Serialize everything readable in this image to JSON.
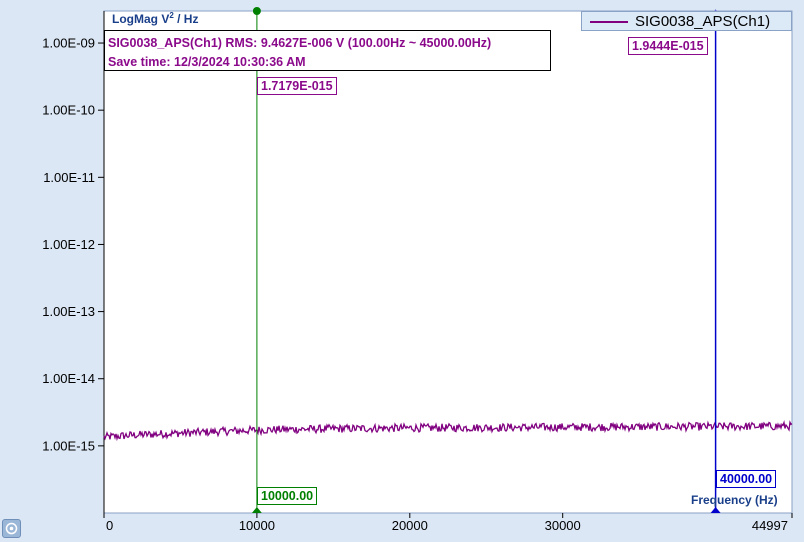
{
  "chart_data": {
    "type": "line",
    "ylabel_text": "LogMag V",
    "ylabel_sup": "2",
    "ylabel_tail": " / Hz",
    "xlabel": "Frequency (Hz)",
    "yscale": "log",
    "ylim": [
      1e-16,
      3e-09
    ],
    "xlim": [
      0,
      44997
    ],
    "ytick_values": [
      1e-09,
      1e-10,
      1e-11,
      1e-12,
      1e-13,
      1e-14,
      1e-15
    ],
    "ytick_labels": [
      "1.00E-09",
      "1.00E-10",
      "1.00E-11",
      "1.00E-12",
      "1.00E-13",
      "1.00E-14",
      "1.00E-15"
    ],
    "xtick_values": [
      0,
      10000,
      20000,
      30000,
      44997
    ],
    "xtick_labels": [
      "0",
      "10000",
      "20000",
      "30000",
      "44997"
    ],
    "series": [
      {
        "name": "SIG0038_APS(Ch1)",
        "color": "#800080",
        "x": [
          0,
          2000,
          5000,
          8000,
          10000,
          12000,
          15000,
          18000,
          20000,
          25000,
          30000,
          35000,
          40000,
          44997
        ],
        "y": [
          1.35e-15,
          1.45e-15,
          1.55e-15,
          1.65e-15,
          1.72e-15,
          1.76e-15,
          1.8e-15,
          1.83e-15,
          1.85e-15,
          1.87e-15,
          1.9e-15,
          1.92e-15,
          1.94e-15,
          1.97e-15
        ]
      }
    ],
    "annotations": {
      "info_line1": "SIG0038_APS(Ch1) RMS: 9.4627E-006 V (100.00Hz ~ 45000.00Hz)",
      "info_line2": "Save time: 12/3/2024 10:30:36 AM"
    },
    "cursors": [
      {
        "x": 10000,
        "x_label": "10000.00",
        "y_label": "1.7179E-015",
        "color": "#008000"
      },
      {
        "x": 40000,
        "x_label": "40000.00",
        "y_label": "1.9444E-015",
        "color": "#0000cc"
      }
    ],
    "legend_position": "top-right",
    "grid": false
  },
  "colors": {
    "background": "#dbe7f5",
    "plot_background": "#ffffff",
    "series": "#800080",
    "cursor1": "#008000",
    "cursor2": "#0000cc",
    "label_text": "#1a3f8a"
  }
}
